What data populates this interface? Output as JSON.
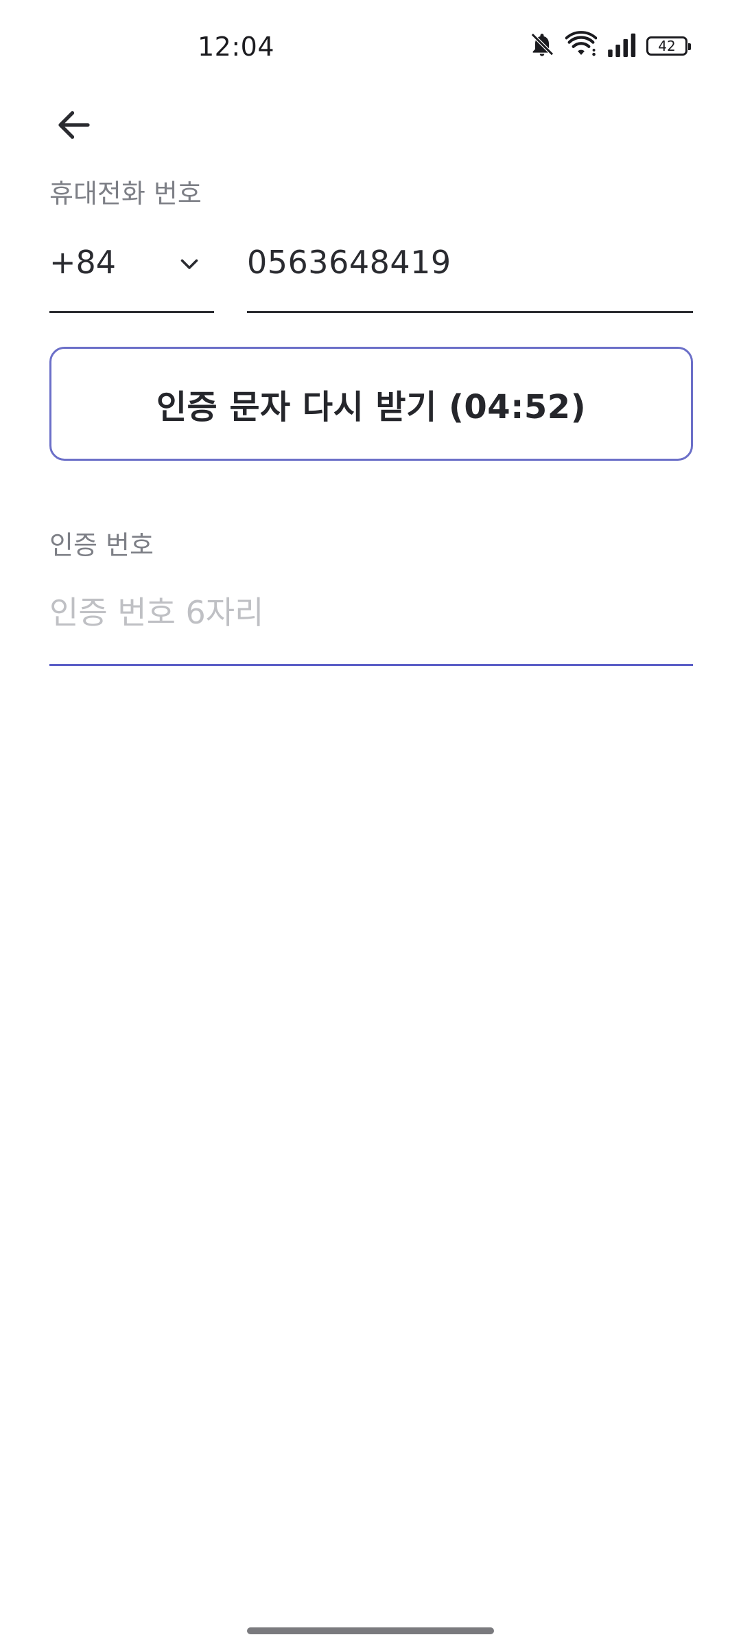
{
  "status_bar": {
    "time": "12:04",
    "icons": [
      "bell-off-icon",
      "wifi-icon",
      "signal-icon",
      "battery-icon"
    ],
    "battery_level": "42"
  },
  "header": {
    "back_icon": "arrow-left-icon"
  },
  "phone": {
    "label": "휴대전화 번호",
    "country_code": "+84",
    "chevron_icon": "chevron-down-icon",
    "number": "0563648419"
  },
  "resend": {
    "label": "인증 문자 다시 받기 (04:52)"
  },
  "verification": {
    "label": "인증 번호",
    "placeholder": "인증 번호 6자리",
    "value": ""
  },
  "colors": {
    "accent": "#5b5fc7",
    "button_border": "#6b6fc8",
    "text_primary": "#2a2b30",
    "text_secondary": "#7d7f86",
    "placeholder": "#bfc0c4"
  }
}
